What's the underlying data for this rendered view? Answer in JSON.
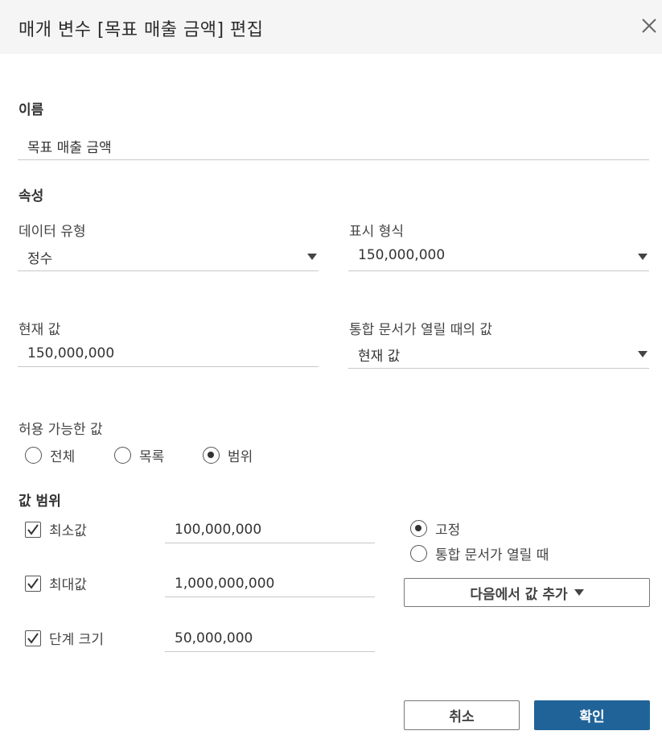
{
  "dialog": {
    "title": "매개 변수 [목표 매출 금액] 편집"
  },
  "name_section": {
    "label": "이름",
    "value": "목표 매출 금액"
  },
  "properties": {
    "label": "속성",
    "data_type_label": "데이터 유형",
    "data_type_value": "정수",
    "display_format_label": "표시 형식",
    "display_format_value": "150,000,000",
    "current_value_label": "현재 값",
    "current_value": "150,000,000",
    "workbook_open_label": "통합 문서가 열릴 때의 값",
    "workbook_open_value": "현재 값"
  },
  "allowable_values": {
    "label": "허용 가능한 값",
    "options": [
      "전체",
      "목록",
      "범위"
    ],
    "selected": "범위"
  },
  "range": {
    "label": "값 범위",
    "min_label": "최소값",
    "min_checked": true,
    "min_value": "100,000,000",
    "max_label": "최대값",
    "max_checked": true,
    "max_value": "1,000,000,000",
    "step_label": "단계 크기",
    "step_checked": true,
    "step_value": "50,000,000",
    "fixed_label": "고정",
    "on_open_label": "통합 문서가 열릴 때",
    "selected_mode": "고정",
    "add_from_label": "다음에서 값 추가"
  },
  "footer": {
    "cancel_label": "취소",
    "ok_label": "확인"
  },
  "colors": {
    "header_bg": "#f5f5f5",
    "primary": "#1f6399",
    "divider": "#c8c8c8"
  },
  "icons": {
    "close": "close-icon",
    "caret": "caret-down-icon",
    "check": "checkmark-icon"
  }
}
